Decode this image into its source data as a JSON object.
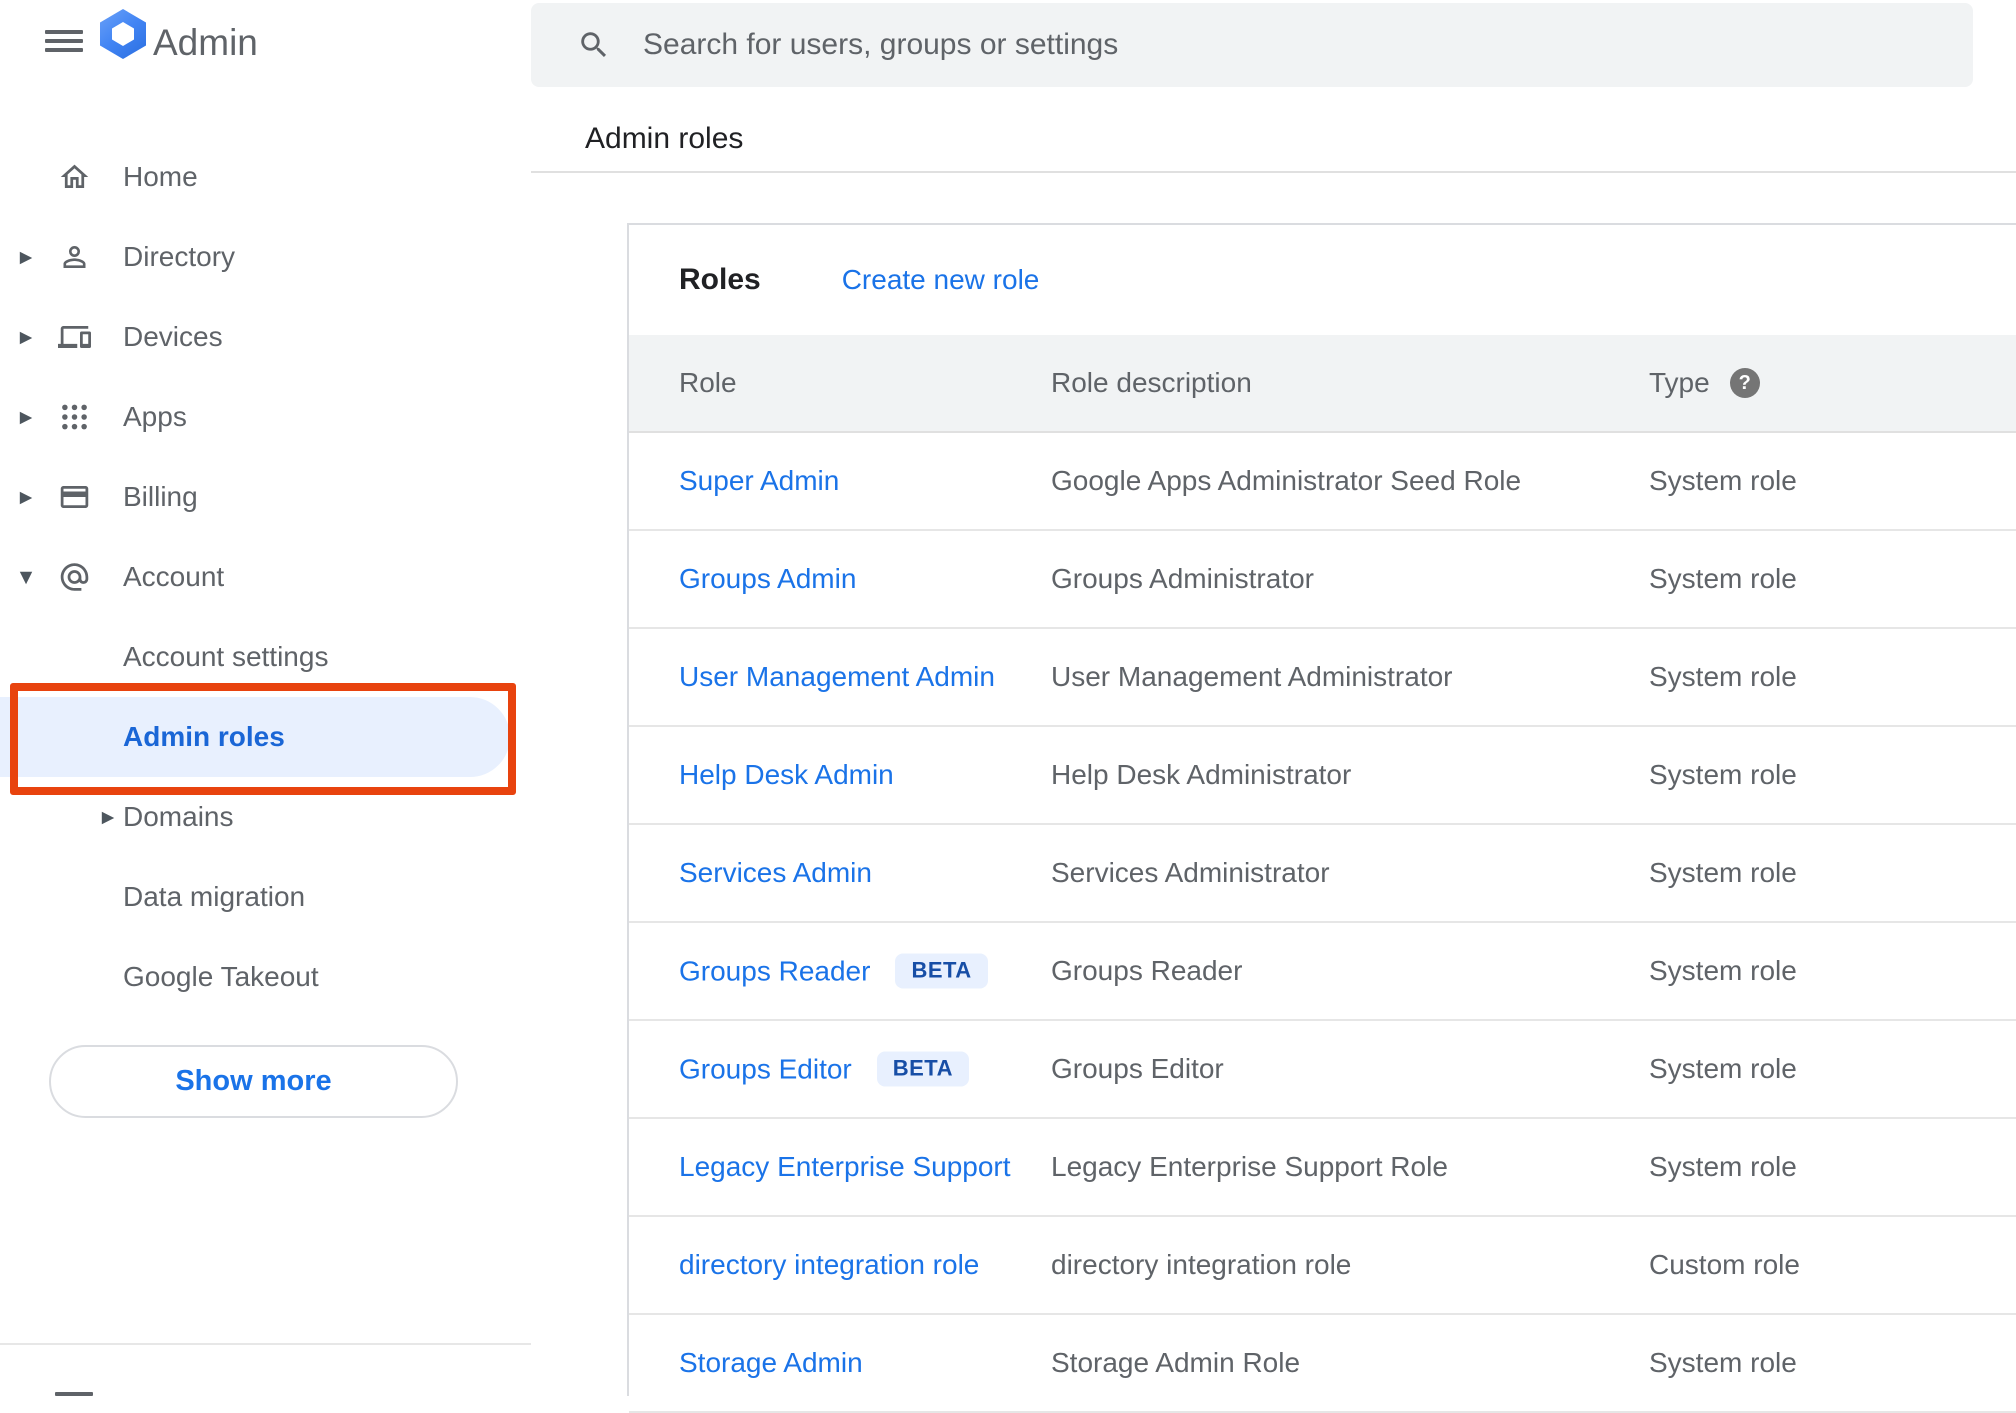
{
  "header": {
    "app_title": "Admin",
    "search": {
      "placeholder": "Search for users, groups or settings"
    },
    "breadcrumb": "Admin roles"
  },
  "sidebar": {
    "items": [
      {
        "label": "Home",
        "icon": "home",
        "arrow": "none",
        "level": 0,
        "selected": false
      },
      {
        "label": "Directory",
        "icon": "person",
        "arrow": "right",
        "level": 0,
        "selected": false
      },
      {
        "label": "Devices",
        "icon": "devices",
        "arrow": "right",
        "level": 0,
        "selected": false
      },
      {
        "label": "Apps",
        "icon": "apps-grid",
        "arrow": "right",
        "level": 0,
        "selected": false
      },
      {
        "label": "Billing",
        "icon": "credit-card",
        "arrow": "right",
        "level": 0,
        "selected": false
      },
      {
        "label": "Account",
        "icon": "at-sign",
        "arrow": "down",
        "level": 0,
        "selected": false
      },
      {
        "label": "Account settings",
        "icon": null,
        "arrow": "none",
        "level": 1,
        "selected": false
      },
      {
        "label": "Admin roles",
        "icon": null,
        "arrow": "none",
        "level": 1,
        "selected": true,
        "annotated": true
      },
      {
        "label": "Domains",
        "icon": null,
        "arrow": "right",
        "level": 1,
        "selected": false
      },
      {
        "label": "Data migration",
        "icon": null,
        "arrow": "none",
        "level": 1,
        "selected": false
      },
      {
        "label": "Google Takeout",
        "icon": null,
        "arrow": "none",
        "level": 1,
        "selected": false
      }
    ],
    "show_more_label": "Show more"
  },
  "roles": {
    "title": "Roles",
    "create_link": "Create new role",
    "columns": {
      "role": "Role",
      "description": "Role description",
      "type": "Type"
    },
    "beta_badge_label": "BETA",
    "rows": [
      {
        "role": "Super Admin",
        "beta": false,
        "description": "Google Apps Administrator Seed Role",
        "type": "System role"
      },
      {
        "role": "Groups Admin",
        "beta": false,
        "description": "Groups Administrator",
        "type": "System role"
      },
      {
        "role": "User Management Admin",
        "beta": false,
        "description": "User Management Administrator",
        "type": "System role"
      },
      {
        "role": "Help Desk Admin",
        "beta": false,
        "description": "Help Desk Administrator",
        "type": "System role"
      },
      {
        "role": "Services Admin",
        "beta": false,
        "description": "Services Administrator",
        "type": "System role"
      },
      {
        "role": "Groups Reader",
        "beta": true,
        "description": "Groups Reader",
        "type": "System role"
      },
      {
        "role": "Groups Editor",
        "beta": true,
        "description": "Groups Editor",
        "type": "System role"
      },
      {
        "role": "Legacy Enterprise Support",
        "beta": false,
        "description": "Legacy Enterprise Support Role",
        "type": "System role"
      },
      {
        "role": "directory integration role",
        "beta": false,
        "description": "directory integration role",
        "type": "Custom role"
      },
      {
        "role": "Storage Admin",
        "beta": false,
        "description": "Storage Admin Role",
        "type": "System role"
      }
    ]
  },
  "colors": {
    "link_blue": "#1a73e8",
    "selected_item_blue": "#1a66d6",
    "selected_item_bg": "#e8f0fe",
    "beta_text": "#174ea6",
    "beta_bg": "#e8f0fe",
    "annotation_red": "#e8430e",
    "text_dark": "#202124",
    "text_gray": "#5f6368",
    "table_header_bg": "#f1f3f4",
    "search_bg": "#f1f3f4",
    "divider": "#e0e0e0"
  }
}
